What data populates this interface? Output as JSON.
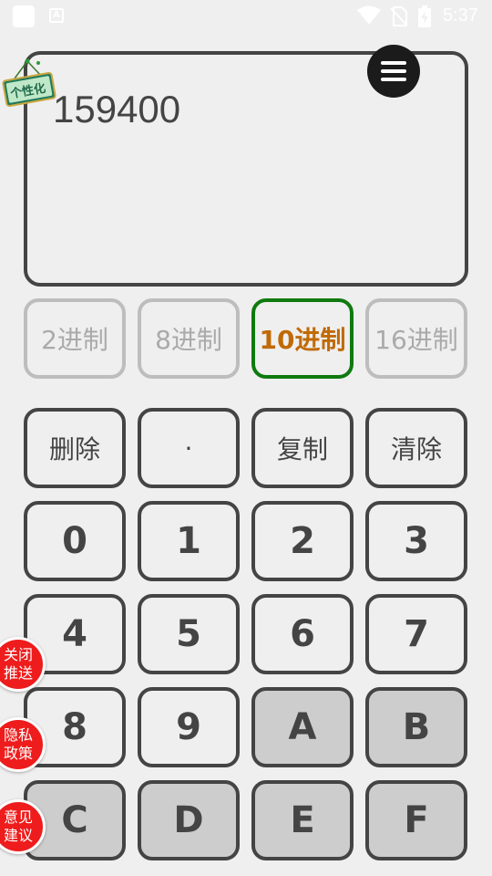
{
  "status_bar": {
    "time": "5:37",
    "icons": [
      "app-icon",
      "font-icon",
      "wifi-icon",
      "no-sim-icon",
      "battery-charging-icon"
    ]
  },
  "display": {
    "value": "159400",
    "menu_icon": "menu-icon",
    "badge_text": "个性化"
  },
  "bases": [
    {
      "label": "2进制",
      "active": false
    },
    {
      "label": "8进制",
      "active": false
    },
    {
      "label": "10进制",
      "active": true
    },
    {
      "label": "16进制",
      "active": false
    }
  ],
  "keypad": {
    "row1": [
      "删除",
      "·",
      "复制",
      "清除"
    ],
    "row2": [
      "0",
      "1",
      "2",
      "3"
    ],
    "row3": [
      "4",
      "5",
      "6",
      "7"
    ],
    "row4": [
      "8",
      "9",
      "A",
      "B"
    ],
    "row5": [
      "C",
      "D",
      "E",
      "F"
    ]
  },
  "floating": [
    {
      "line1": "关闭",
      "line2": "推送"
    },
    {
      "line1": "隐私",
      "line2": "政策"
    },
    {
      "line1": "意见",
      "line2": "建议"
    }
  ],
  "colors": {
    "active_border": "#0f7a0f",
    "active_text": "#c06a06",
    "float_bg": "#ee1c1c"
  }
}
